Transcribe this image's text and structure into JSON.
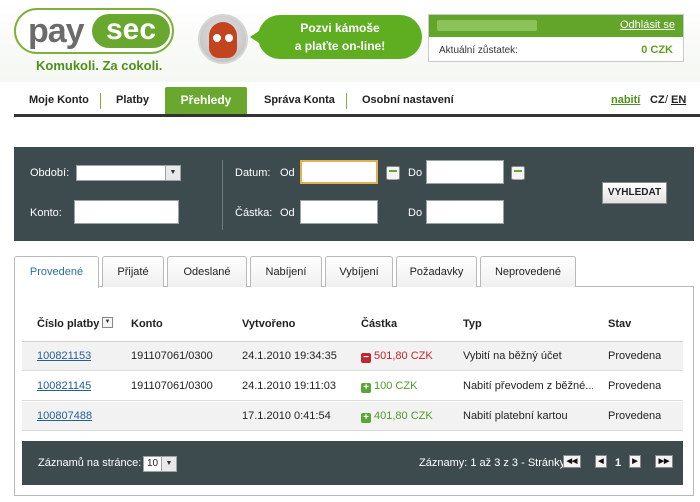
{
  "header": {
    "logo_left": "pay",
    "logo_right": "sec",
    "tagline": "Komukoli. Za cokoli.",
    "promo_line1": "Pozvi kámoše",
    "promo_line2": "a plaťte on-line!",
    "logout": "Odhlásit se",
    "balance_label": "Aktuální zůstatek:",
    "balance_value": "0 CZK"
  },
  "nav": {
    "items": [
      "Moje Konto",
      "Platby",
      "Přehledy",
      "Správa Konta",
      "Osobní nastavení"
    ],
    "active": "Přehledy",
    "topup": "nabití",
    "lang_cz": "CZ",
    "lang_sep": "/",
    "lang_en": "EN"
  },
  "filter": {
    "period_label": "Období:",
    "period_value": "",
    "account_label": "Konto:",
    "date_label": "Datum:",
    "amount_label": "Částka:",
    "from_label": "Od",
    "to_label": "Do",
    "search_button": "VYHLEDAT"
  },
  "tabs": [
    "Provedené",
    "Přijaté",
    "Odeslané",
    "Nabíjení",
    "Vybíjení",
    "Požadavky",
    "Neprovedené"
  ],
  "active_tab": "Provedené",
  "table": {
    "columns": [
      "Číslo platby",
      "Konto",
      "Vytvořeno",
      "Částka",
      "Typ",
      "Stav"
    ],
    "sort_icon": "▼",
    "rows": [
      {
        "id": "100821153",
        "account": "191107061/0300",
        "created": "24.1.2010 19:34:35",
        "amount": "501,80 CZK",
        "sign": "−",
        "type": "Vybití na běžný účet",
        "status": "Provedena"
      },
      {
        "id": "100821145",
        "account": "191107061/0300",
        "created": "24.1.2010 19:11:03",
        "amount": "100 CZK",
        "sign": "+",
        "type": "Nabití převodem z běžné...",
        "status": "Provedena"
      },
      {
        "id": "100807488",
        "account": "",
        "created": "17.1.2010 0:41:54",
        "amount": "401,80 CZK",
        "sign": "+",
        "type": "Nabití platební kartou",
        "status": "Provedena"
      }
    ]
  },
  "footer": {
    "per_page_label": "Záznamů na stránce:",
    "per_page_value": "10",
    "summary": "Záznamy: 1 až 3 z 3 - Stránky:",
    "first": "◀◀",
    "prev": "◀",
    "page": "1",
    "next": "▶",
    "last": "▶▶"
  },
  "colors": {
    "brand_green": "#6aa72e",
    "panel_dark": "#3d4b4f",
    "negative": "#c0262d",
    "positive": "#4f9b2a",
    "link": "#245f96"
  }
}
